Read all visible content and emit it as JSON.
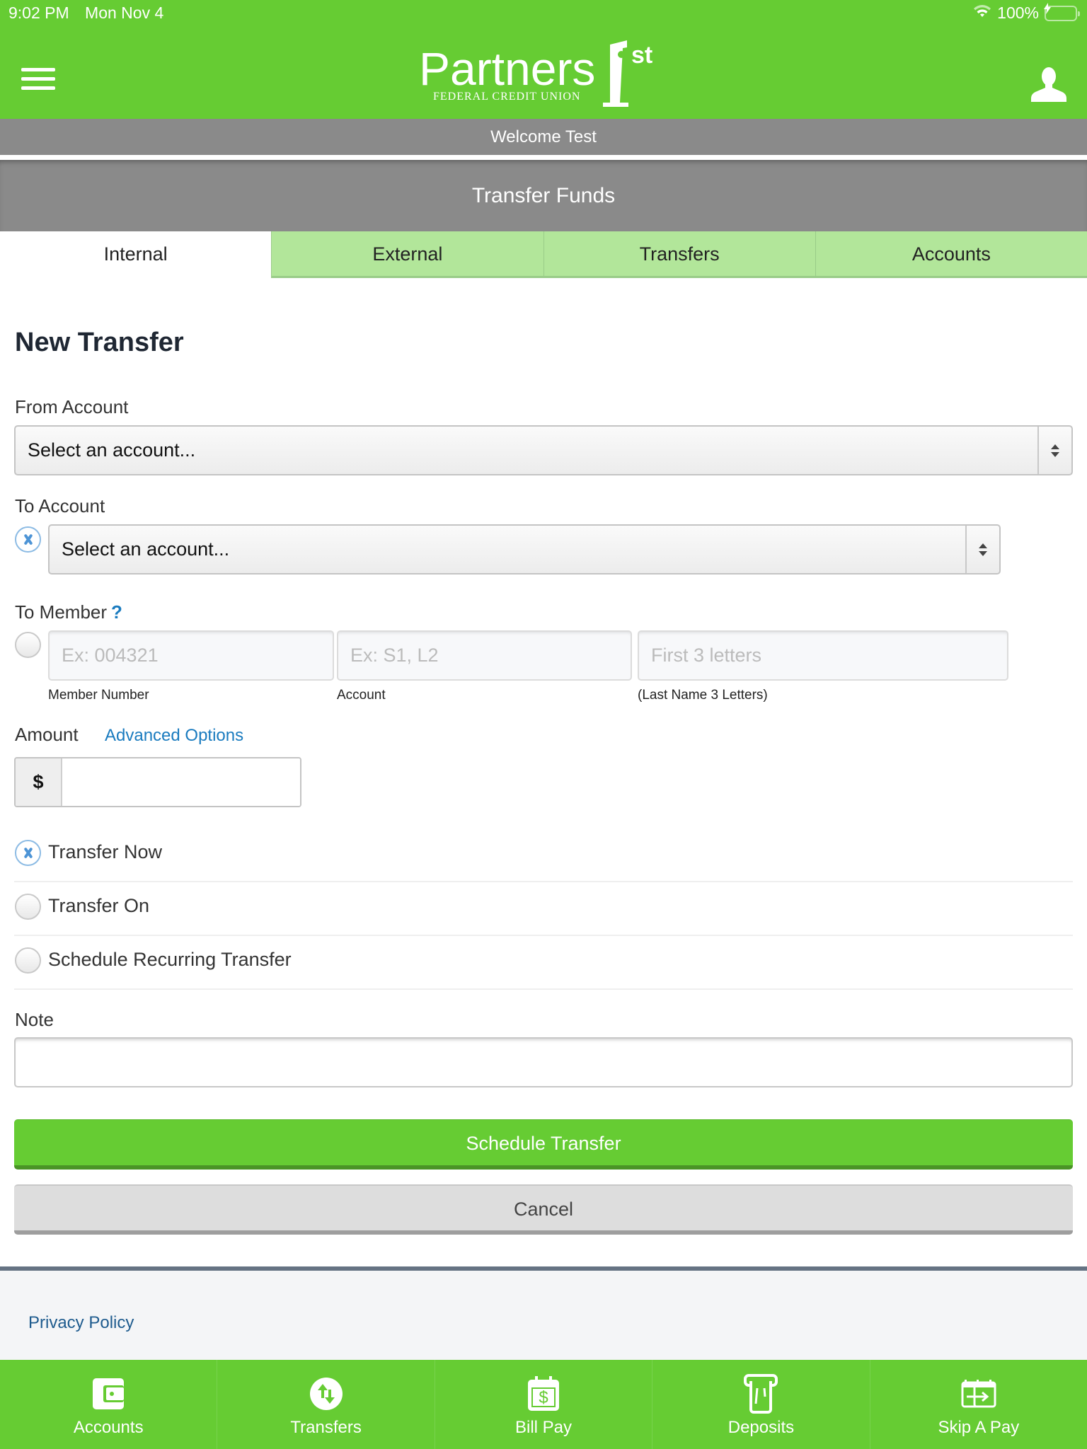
{
  "status_bar": {
    "time": "9:02 PM",
    "date": "Mon Nov 4",
    "battery_percent": "100%",
    "charging": true
  },
  "header": {
    "logo_text": "Partners",
    "logo_superscript": "st",
    "logo_subtitle": "FEDERAL CREDIT UNION",
    "menu_icon": "hamburger-menu-icon",
    "profile_icon": "user-profile-icon",
    "brand_color": "#66cc33"
  },
  "welcome": "Welcome Test",
  "page_title": "Transfer Funds",
  "tabs": [
    {
      "label": "Internal",
      "active": true
    },
    {
      "label": "External",
      "active": false
    },
    {
      "label": "Transfers",
      "active": false
    },
    {
      "label": "Accounts",
      "active": false
    }
  ],
  "form": {
    "heading": "New Transfer",
    "from_account": {
      "label": "From Account",
      "value": "Select an account..."
    },
    "to_account": {
      "label": "To Account",
      "value": "Select an account...",
      "selected": true
    },
    "to_member": {
      "label": "To Member",
      "help": "?",
      "selected": false,
      "fields": [
        {
          "placeholder": "Ex: 004321",
          "sublabel": "Member Number"
        },
        {
          "placeholder": "Ex: S1, L2",
          "sublabel": "Account"
        },
        {
          "placeholder": "First  3  letters",
          "sublabel": "(Last Name  3  Letters)"
        }
      ]
    },
    "amount": {
      "label": "Amount",
      "link": "Advanced Options",
      "prefix": "$",
      "value": ""
    },
    "timing_options": [
      {
        "label": "Transfer Now",
        "selected": true
      },
      {
        "label": "Transfer On",
        "selected": false
      },
      {
        "label": "Schedule Recurring Transfer",
        "selected": false
      }
    ],
    "note": {
      "label": "Note",
      "value": ""
    },
    "submit_label": "Schedule Transfer",
    "cancel_label": "Cancel"
  },
  "footer": {
    "privacy_link": "Privacy Policy"
  },
  "bottom_nav": [
    {
      "label": "Accounts",
      "icon": "wallet-icon"
    },
    {
      "label": "Transfers",
      "icon": "transfer-arrows-icon"
    },
    {
      "label": "Bill Pay",
      "icon": "calendar-dollar-icon"
    },
    {
      "label": "Deposits",
      "icon": "check-deposit-icon"
    },
    {
      "label": "Skip A Pay",
      "icon": "calendar-skip-icon"
    }
  ]
}
